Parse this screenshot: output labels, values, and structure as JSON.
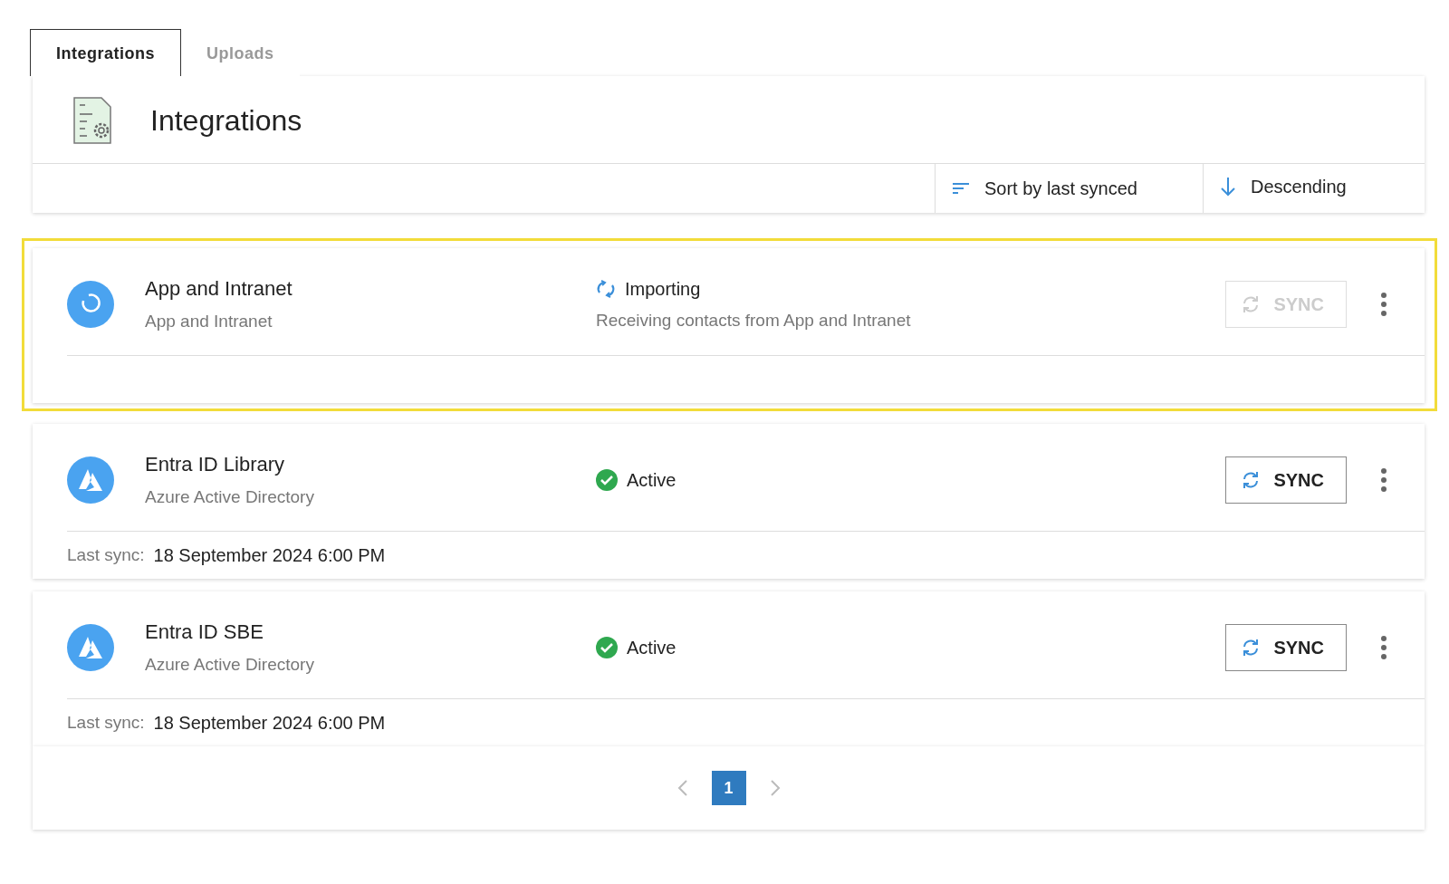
{
  "tabs": [
    {
      "label": "Integrations",
      "selected": true
    },
    {
      "label": "Uploads",
      "selected": false
    }
  ],
  "header": {
    "title": "Integrations"
  },
  "sort": {
    "label": "Sort by last synced",
    "order": "Descending"
  },
  "integrations": [
    {
      "name": "App and Intranet",
      "source": "App and Intranet",
      "kind": "app",
      "highlighted": true,
      "status": {
        "kind": "importing",
        "label": "Importing"
      },
      "description": "Receiving contacts from App and Intranet",
      "sync": {
        "label": "SYNC",
        "disabled": true
      }
    },
    {
      "name": "Entra ID Library",
      "source": "Azure Active Directory",
      "kind": "azure",
      "highlighted": false,
      "status": {
        "kind": "active",
        "label": "Active"
      },
      "sync": {
        "label": "SYNC",
        "disabled": false
      },
      "last_sync": {
        "label": "Last sync:",
        "value": "18 September 2024 6:00 PM"
      }
    },
    {
      "name": "Entra ID SBE",
      "source": "Azure Active Directory",
      "kind": "azure",
      "highlighted": false,
      "status": {
        "kind": "active",
        "label": "Active"
      },
      "sync": {
        "label": "SYNC",
        "disabled": false
      },
      "last_sync": {
        "label": "Last sync:",
        "value": "18 September 2024 6:00 PM"
      }
    }
  ],
  "pagination": {
    "pages": [
      {
        "label": "1",
        "selected": true
      }
    ]
  }
}
